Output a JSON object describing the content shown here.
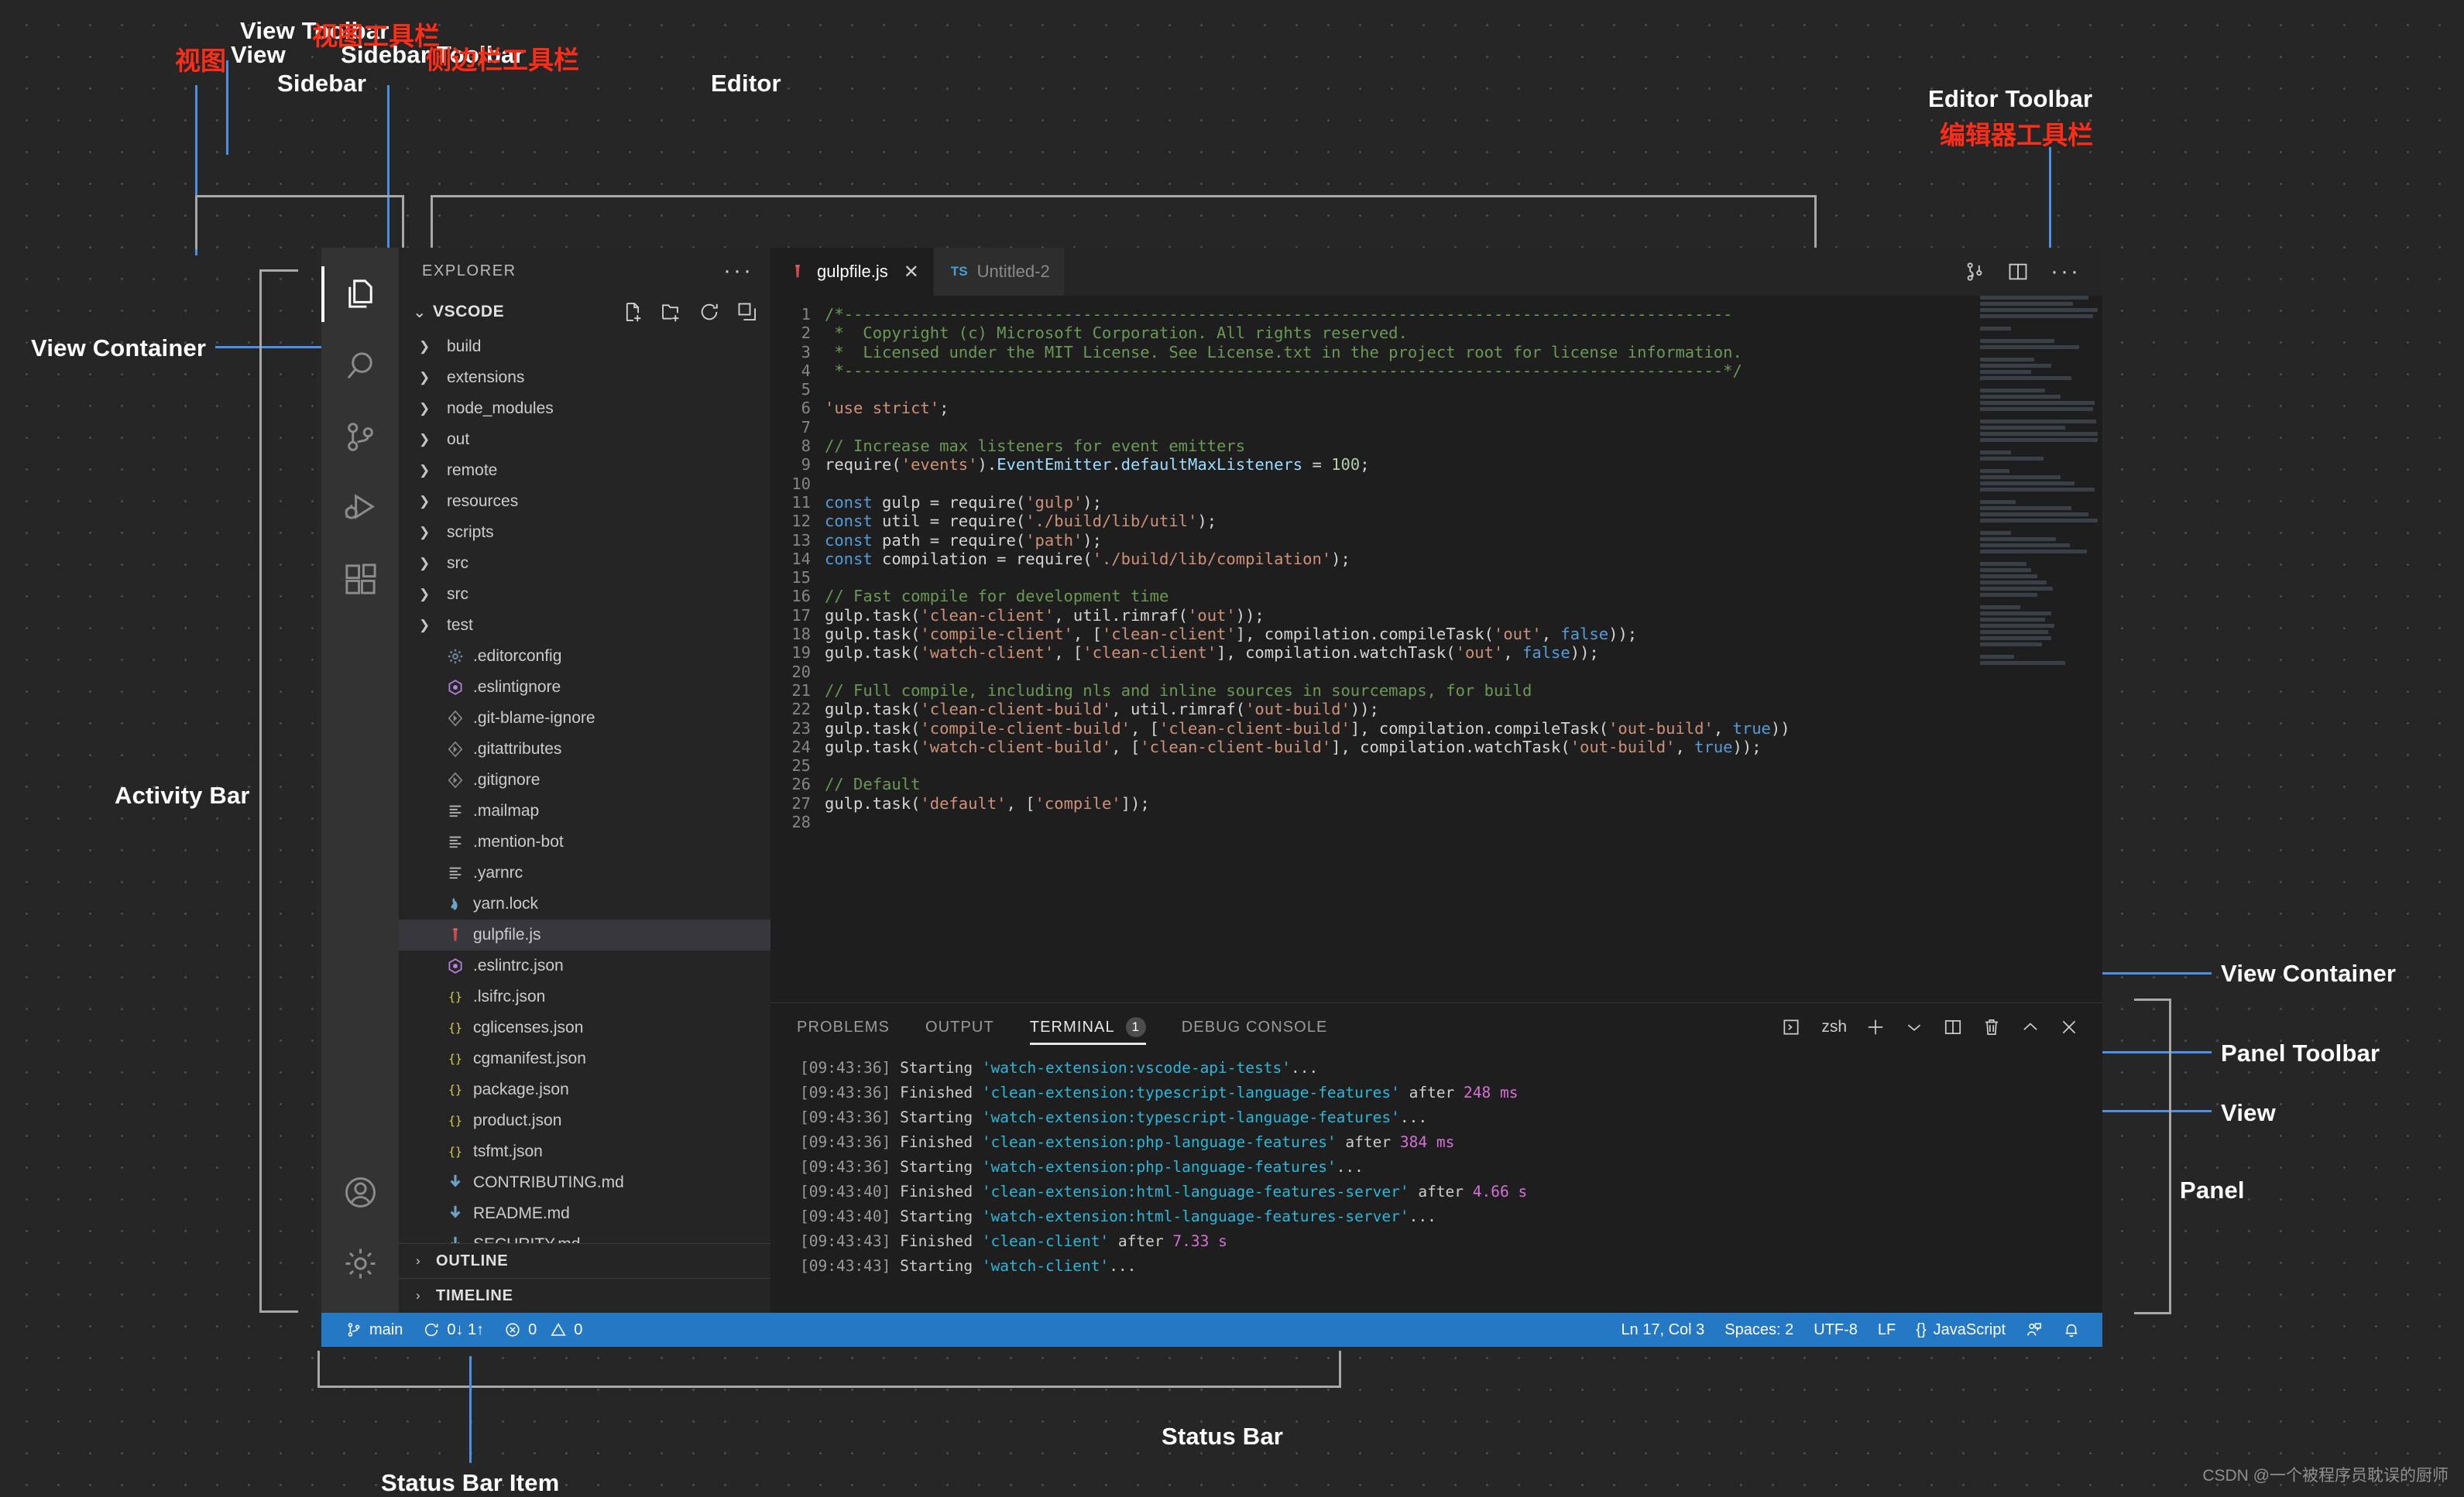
{
  "annotations": {
    "view_toolbar_en": "View Toolbar",
    "view_toolbar_cn": "视图工具栏",
    "view_cn": "视图",
    "view_en": "View",
    "sidebar_toolbar_en": "Sidebar Toolbar",
    "sidebar_toolbar_cn": "侧边栏工具栏",
    "sidebar": "Sidebar",
    "editor": "Editor",
    "editor_toolbar_en": "Editor Toolbar",
    "editor_toolbar_cn": "编辑器工具栏",
    "view_container_left": "View Container",
    "activity_bar": "Activity Bar",
    "view_container_right": "View Container",
    "panel_toolbar": "Panel Toolbar",
    "view_right": "View",
    "panel": "Panel",
    "status_bar": "Status Bar",
    "status_bar_item": "Status Bar Item",
    "watermark": "CSDN @一个被程序员耽误的厨师"
  },
  "activity_bar": {
    "items": [
      {
        "name": "explorer",
        "icon": "files-icon",
        "active": true
      },
      {
        "name": "search",
        "icon": "search-icon",
        "active": false
      },
      {
        "name": "source-control",
        "icon": "source-control-icon",
        "active": false
      },
      {
        "name": "run-and-debug",
        "icon": "debug-icon",
        "active": false
      },
      {
        "name": "extensions",
        "icon": "extensions-icon",
        "active": false
      }
    ],
    "bottom": [
      {
        "name": "accounts",
        "icon": "account-icon"
      },
      {
        "name": "manage",
        "icon": "gear-icon"
      }
    ]
  },
  "sidebar": {
    "title": "EXPLORER",
    "more_label": "···",
    "section_title": "VSCODE",
    "section_chevron": "⌄",
    "toolbar": [
      {
        "name": "new-file-icon",
        "title": "New File"
      },
      {
        "name": "new-folder-icon",
        "title": "New Folder"
      },
      {
        "name": "refresh-icon",
        "title": "Refresh Explorer"
      },
      {
        "name": "collapse-all-icon",
        "title": "Collapse Folders"
      }
    ],
    "tree": [
      {
        "label": "build",
        "type": "folder",
        "icon": "chevron-right-icon"
      },
      {
        "label": "extensions",
        "type": "folder",
        "icon": "chevron-right-icon"
      },
      {
        "label": "node_modules",
        "type": "folder",
        "icon": "chevron-right-icon"
      },
      {
        "label": "out",
        "type": "folder",
        "icon": "chevron-right-icon"
      },
      {
        "label": "remote",
        "type": "folder",
        "icon": "chevron-right-icon"
      },
      {
        "label": "resources",
        "type": "folder",
        "icon": "chevron-right-icon"
      },
      {
        "label": "scripts",
        "type": "folder",
        "icon": "chevron-right-icon"
      },
      {
        "label": "src",
        "type": "folder",
        "icon": "chevron-right-icon"
      },
      {
        "label": "src",
        "type": "folder",
        "icon": "chevron-right-icon"
      },
      {
        "label": "test",
        "type": "folder",
        "icon": "chevron-right-icon"
      },
      {
        "label": ".editorconfig",
        "type": "file",
        "icon": "gear-file-icon",
        "color": "#6d8a96"
      },
      {
        "label": ".eslintignore",
        "type": "file",
        "icon": "eslint-icon",
        "color": "#b07fd8"
      },
      {
        "label": ".git-blame-ignore",
        "type": "file",
        "icon": "git-icon",
        "color": "#8a8a8a"
      },
      {
        "label": ".gitattributes",
        "type": "file",
        "icon": "git-icon",
        "color": "#8a8a8a"
      },
      {
        "label": ".gitignore",
        "type": "file",
        "icon": "git-icon",
        "color": "#8a8a8a"
      },
      {
        "label": ".mailmap",
        "type": "file",
        "icon": "text-file-icon",
        "color": "#b8b8b8"
      },
      {
        "label": ".mention-bot",
        "type": "file",
        "icon": "text-file-icon",
        "color": "#b8b8b8"
      },
      {
        "label": ".yarnrc",
        "type": "file",
        "icon": "text-file-icon",
        "color": "#b8b8b8"
      },
      {
        "label": "yarn.lock",
        "type": "file",
        "icon": "yarn-icon",
        "color": "#6ba3c9"
      },
      {
        "label": "gulpfile.js",
        "type": "file",
        "icon": "gulp-icon",
        "color": "#cf4b4b",
        "selected": true
      },
      {
        "label": ".eslintrc.json",
        "type": "file",
        "icon": "eslint-icon",
        "color": "#b07fd8"
      },
      {
        "label": ".lsifrc.json",
        "type": "file",
        "icon": "json-icon",
        "color": "#d7d34a"
      },
      {
        "label": "cglicenses.json",
        "type": "file",
        "icon": "json-icon",
        "color": "#d7d34a"
      },
      {
        "label": "cgmanifest.json",
        "type": "file",
        "icon": "json-icon",
        "color": "#d7d34a"
      },
      {
        "label": "package.json",
        "type": "file",
        "icon": "json-icon",
        "color": "#d7d34a"
      },
      {
        "label": "product.json",
        "type": "file",
        "icon": "json-icon",
        "color": "#d7d34a"
      },
      {
        "label": "tsfmt.json",
        "type": "file",
        "icon": "json-icon",
        "color": "#d7d34a"
      },
      {
        "label": "CONTRIBUTING.md",
        "type": "file",
        "icon": "markdown-icon",
        "color": "#6ba3c9"
      },
      {
        "label": "README.md",
        "type": "file",
        "icon": "markdown-icon",
        "color": "#6ba3c9"
      },
      {
        "label": "SECURITY.md",
        "type": "file",
        "icon": "markdown-icon",
        "color": "#6ba3c9"
      }
    ],
    "footers": [
      {
        "label": "OUTLINE",
        "chevron": "›"
      },
      {
        "label": "TIMELINE",
        "chevron": "›"
      }
    ]
  },
  "editor": {
    "tabs": [
      {
        "label": "gulpfile.js",
        "icon": "gulp-icon",
        "active": true,
        "close": "✕"
      },
      {
        "label": "Untitled-2",
        "icon": "ts-icon",
        "prefix": "TS",
        "active": false
      }
    ],
    "toolbar": [
      {
        "name": "run-split-icon"
      },
      {
        "name": "split-editor-icon"
      },
      {
        "name": "more-actions-icon",
        "label": "···"
      }
    ],
    "lines": [
      {
        "n": 1,
        "tokens": [
          {
            "t": "/*---------------------------------------------------------------------------------------------",
            "c": "c-com"
          }
        ]
      },
      {
        "n": 2,
        "tokens": [
          {
            "t": " *  Copyright (c) Microsoft Corporation. All rights reserved.",
            "c": "c-com"
          }
        ]
      },
      {
        "n": 3,
        "tokens": [
          {
            "t": " *  Licensed under the MIT License. See License.txt in the project root for license information.",
            "c": "c-com"
          }
        ]
      },
      {
        "n": 4,
        "tokens": [
          {
            "t": " *--------------------------------------------------------------------------------------------*/",
            "c": "c-com"
          }
        ]
      },
      {
        "n": 5,
        "tokens": []
      },
      {
        "n": 6,
        "tokens": [
          {
            "t": "'use strict'",
            "c": "c-str"
          },
          {
            "t": ";",
            "c": "c-pl"
          }
        ]
      },
      {
        "n": 7,
        "tokens": []
      },
      {
        "n": 8,
        "tokens": [
          {
            "t": "// Increase max listeners for event emitters",
            "c": "c-com"
          }
        ]
      },
      {
        "n": 9,
        "tokens": [
          {
            "t": "require(",
            "c": "c-pl"
          },
          {
            "t": "'events'",
            "c": "c-str"
          },
          {
            "t": ").",
            "c": "c-pl"
          },
          {
            "t": "EventEmitter",
            "c": "c-var"
          },
          {
            "t": ".",
            "c": "c-pl"
          },
          {
            "t": "defaultMaxListeners",
            "c": "c-var"
          },
          {
            "t": " = ",
            "c": "c-pl"
          },
          {
            "t": "100",
            "c": "c-num"
          },
          {
            "t": ";",
            "c": "c-pl"
          }
        ]
      },
      {
        "n": 10,
        "tokens": []
      },
      {
        "n": 11,
        "tokens": [
          {
            "t": "const",
            "c": "c-kw"
          },
          {
            "t": " gulp = require(",
            "c": "c-pl"
          },
          {
            "t": "'gulp'",
            "c": "c-str"
          },
          {
            "t": ");",
            "c": "c-pl"
          }
        ]
      },
      {
        "n": 12,
        "tokens": [
          {
            "t": "const",
            "c": "c-kw"
          },
          {
            "t": " util = require(",
            "c": "c-pl"
          },
          {
            "t": "'./build/lib/util'",
            "c": "c-str"
          },
          {
            "t": ");",
            "c": "c-pl"
          }
        ]
      },
      {
        "n": 13,
        "tokens": [
          {
            "t": "const",
            "c": "c-kw"
          },
          {
            "t": " path = require(",
            "c": "c-pl"
          },
          {
            "t": "'path'",
            "c": "c-str"
          },
          {
            "t": ");",
            "c": "c-pl"
          }
        ]
      },
      {
        "n": 14,
        "tokens": [
          {
            "t": "const",
            "c": "c-kw"
          },
          {
            "t": " compilation = require(",
            "c": "c-pl"
          },
          {
            "t": "'./build/lib/compilation'",
            "c": "c-str"
          },
          {
            "t": ");",
            "c": "c-pl"
          }
        ]
      },
      {
        "n": 15,
        "tokens": []
      },
      {
        "n": 16,
        "tokens": [
          {
            "t": "// Fast compile for development time",
            "c": "c-com"
          }
        ]
      },
      {
        "n": 17,
        "tokens": [
          {
            "t": "gulp.task(",
            "c": "c-pl"
          },
          {
            "t": "'clean-client'",
            "c": "c-str"
          },
          {
            "t": ", util.rimraf(",
            "c": "c-pl"
          },
          {
            "t": "'out'",
            "c": "c-str"
          },
          {
            "t": "));",
            "c": "c-pl"
          }
        ]
      },
      {
        "n": 18,
        "tokens": [
          {
            "t": "gulp.task(",
            "c": "c-pl"
          },
          {
            "t": "'compile-client'",
            "c": "c-str"
          },
          {
            "t": ", [",
            "c": "c-pl"
          },
          {
            "t": "'clean-client'",
            "c": "c-str"
          },
          {
            "t": "], compilation.compileTask(",
            "c": "c-pl"
          },
          {
            "t": "'out'",
            "c": "c-str"
          },
          {
            "t": ", ",
            "c": "c-pl"
          },
          {
            "t": "false",
            "c": "c-kw"
          },
          {
            "t": "));",
            "c": "c-pl"
          }
        ]
      },
      {
        "n": 19,
        "tokens": [
          {
            "t": "gulp.task(",
            "c": "c-pl"
          },
          {
            "t": "'watch-client'",
            "c": "c-str"
          },
          {
            "t": ", [",
            "c": "c-pl"
          },
          {
            "t": "'clean-client'",
            "c": "c-str"
          },
          {
            "t": "], compilation.watchTask(",
            "c": "c-pl"
          },
          {
            "t": "'out'",
            "c": "c-str"
          },
          {
            "t": ", ",
            "c": "c-pl"
          },
          {
            "t": "false",
            "c": "c-kw"
          },
          {
            "t": "));",
            "c": "c-pl"
          }
        ]
      },
      {
        "n": 20,
        "tokens": []
      },
      {
        "n": 21,
        "tokens": [
          {
            "t": "// Full compile, including nls and inline sources in sourcemaps, for build",
            "c": "c-com"
          }
        ]
      },
      {
        "n": 22,
        "tokens": [
          {
            "t": "gulp.task(",
            "c": "c-pl"
          },
          {
            "t": "'clean-client-build'",
            "c": "c-str"
          },
          {
            "t": ", util.rimraf(",
            "c": "c-pl"
          },
          {
            "t": "'out-build'",
            "c": "c-str"
          },
          {
            "t": "));",
            "c": "c-pl"
          }
        ]
      },
      {
        "n": 23,
        "tokens": [
          {
            "t": "gulp.task(",
            "c": "c-pl"
          },
          {
            "t": "'compile-client-build'",
            "c": "c-str"
          },
          {
            "t": ", [",
            "c": "c-pl"
          },
          {
            "t": "'clean-client-build'",
            "c": "c-str"
          },
          {
            "t": "], compilation.compileTask(",
            "c": "c-pl"
          },
          {
            "t": "'out-build'",
            "c": "c-str"
          },
          {
            "t": ", ",
            "c": "c-pl"
          },
          {
            "t": "true",
            "c": "c-kw"
          },
          {
            "t": "))",
            "c": "c-pl"
          }
        ]
      },
      {
        "n": 24,
        "tokens": [
          {
            "t": "gulp.task(",
            "c": "c-pl"
          },
          {
            "t": "'watch-client-build'",
            "c": "c-str"
          },
          {
            "t": ", [",
            "c": "c-pl"
          },
          {
            "t": "'clean-client-build'",
            "c": "c-str"
          },
          {
            "t": "], compilation.watchTask(",
            "c": "c-pl"
          },
          {
            "t": "'out-build'",
            "c": "c-str"
          },
          {
            "t": ", ",
            "c": "c-pl"
          },
          {
            "t": "true",
            "c": "c-kw"
          },
          {
            "t": "));",
            "c": "c-pl"
          }
        ]
      },
      {
        "n": 25,
        "tokens": []
      },
      {
        "n": 26,
        "tokens": [
          {
            "t": "// Default",
            "c": "c-com"
          }
        ]
      },
      {
        "n": 27,
        "tokens": [
          {
            "t": "gulp.task(",
            "c": "c-pl"
          },
          {
            "t": "'default'",
            "c": "c-str"
          },
          {
            "t": ", [",
            "c": "c-pl"
          },
          {
            "t": "'compile'",
            "c": "c-str"
          },
          {
            "t": "]);",
            "c": "c-pl"
          }
        ]
      },
      {
        "n": 28,
        "tokens": []
      }
    ]
  },
  "panel": {
    "tabs": [
      {
        "label": "PROBLEMS",
        "active": false
      },
      {
        "label": "OUTPUT",
        "active": false
      },
      {
        "label": "TERMINAL",
        "active": true,
        "badge": "1"
      },
      {
        "label": "DEBUG CONSOLE",
        "active": false
      }
    ],
    "toolbar": {
      "shell_icon": "terminal-icon",
      "shell_label": "zsh",
      "new_terminal": "+",
      "dropdown": "⌄",
      "split_icon": "split-terminal-icon",
      "kill_icon": "trash-icon",
      "maximize_icon": "chevron-up-icon",
      "close_icon": "close-icon"
    },
    "terminal_lines": [
      {
        "ts": "[09:43:36]",
        "verb": " Starting ",
        "task": "'watch-extension:vscode-api-tests'",
        "tail": "...",
        "num": ""
      },
      {
        "ts": "[09:43:36]",
        "verb": " Finished ",
        "task": "'clean-extension:typescript-language-features'",
        "tail": " after ",
        "num": "248 ms"
      },
      {
        "ts": "[09:43:36]",
        "verb": " Starting ",
        "task": "'watch-extension:typescript-language-features'",
        "tail": "...",
        "num": ""
      },
      {
        "ts": "[09:43:36]",
        "verb": " Finished ",
        "task": "'clean-extension:php-language-features'",
        "tail": " after ",
        "num": "384 ms"
      },
      {
        "ts": "[09:43:36]",
        "verb": " Starting ",
        "task": "'watch-extension:php-language-features'",
        "tail": "...",
        "num": ""
      },
      {
        "ts": "[09:43:40]",
        "verb": " Finished ",
        "task": "'clean-extension:html-language-features-server'",
        "tail": " after ",
        "num": "4.66 s"
      },
      {
        "ts": "[09:43:40]",
        "verb": " Starting ",
        "task": "'watch-extension:html-language-features-server'",
        "tail": "...",
        "num": ""
      },
      {
        "ts": "[09:43:43]",
        "verb": " Finished ",
        "task": "'clean-client'",
        "tail": " after ",
        "num": "7.33 s"
      },
      {
        "ts": "[09:43:43]",
        "verb": " Starting ",
        "task": "'watch-client'",
        "tail": "...",
        "num": ""
      }
    ]
  },
  "status_bar": {
    "background": "#2579c4",
    "left": [
      {
        "name": "branch",
        "icon": "source-control-icon",
        "label": "main"
      },
      {
        "name": "sync",
        "icon": "sync-icon",
        "label": "0↓ 1↑"
      },
      {
        "name": "problems",
        "icon": "error-warning-icon",
        "label": "0",
        "label2": "0"
      }
    ],
    "right": [
      {
        "name": "cursor-position",
        "label": "Ln 17, Col 3"
      },
      {
        "name": "indentation",
        "label": "Spaces: 2"
      },
      {
        "name": "encoding",
        "label": "UTF-8"
      },
      {
        "name": "eol",
        "label": "LF"
      },
      {
        "name": "language-mode",
        "label": "JavaScript",
        "prefix": "{}"
      },
      {
        "name": "feedback",
        "icon": "feedback-icon"
      },
      {
        "name": "notifications",
        "icon": "bell-icon"
      }
    ]
  }
}
